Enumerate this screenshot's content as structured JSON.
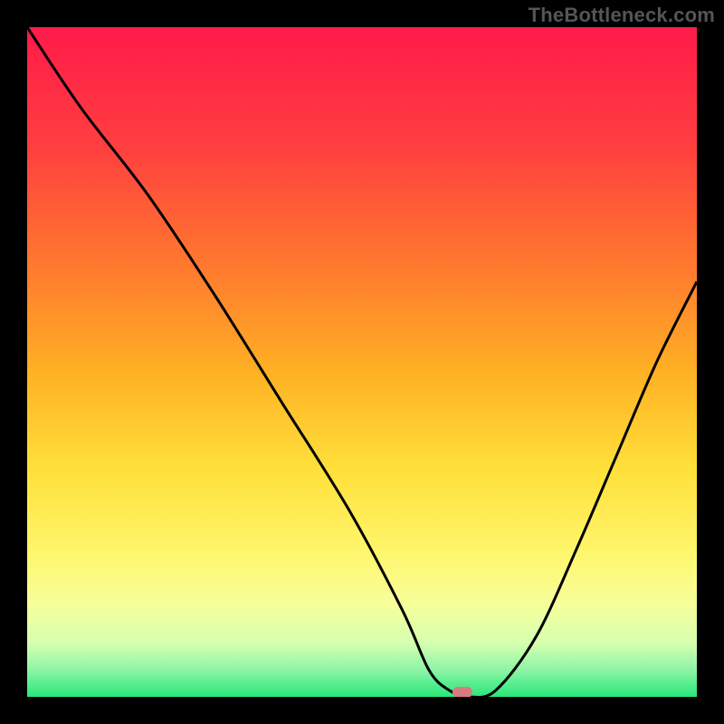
{
  "watermark": "TheBottleneck.com",
  "chart_data": {
    "type": "line",
    "title": "",
    "xlabel": "",
    "ylabel": "",
    "xlim": [
      0,
      100
    ],
    "ylim": [
      0,
      100
    ],
    "grid": false,
    "series": [
      {
        "name": "bottleneck-curve",
        "x": [
          0,
          8,
          18,
          28,
          38,
          48,
          56,
          60,
          63,
          66,
          70,
          76,
          82,
          88,
          94,
          100
        ],
        "y": [
          100,
          88,
          75,
          60,
          44,
          28,
          13,
          4,
          1,
          0,
          1,
          9,
          22,
          36,
          50,
          62
        ]
      }
    ],
    "markers": [
      {
        "name": "sweet-spot",
        "x": 65,
        "y": 0.7,
        "color": "#d77b7f",
        "shape": "pill"
      }
    ],
    "background_gradient": {
      "stops": [
        {
          "offset": 0.0,
          "color": "#ff1a4a"
        },
        {
          "offset": 0.18,
          "color": "#ff3f3f"
        },
        {
          "offset": 0.36,
          "color": "#ff7a2e"
        },
        {
          "offset": 0.52,
          "color": "#ffb224"
        },
        {
          "offset": 0.66,
          "color": "#ffe03a"
        },
        {
          "offset": 0.78,
          "color": "#fff56a"
        },
        {
          "offset": 0.86,
          "color": "#f7ff9a"
        },
        {
          "offset": 0.92,
          "color": "#d6ffb0"
        },
        {
          "offset": 0.96,
          "color": "#8cf5a6"
        },
        {
          "offset": 1.0,
          "color": "#28e67a"
        }
      ]
    }
  }
}
